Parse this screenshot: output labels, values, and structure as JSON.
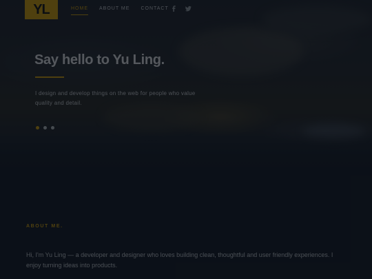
{
  "header": {
    "logo": "YL",
    "nav": [
      "Home",
      "About Me",
      "Contact"
    ],
    "social": [
      "facebook-icon",
      "twitter-icon"
    ]
  },
  "hero": {
    "title": "Say hello to Yu Ling.",
    "subtitle": "I design and develop things on the web for people who value quality and detail.",
    "slides": 3,
    "active_slide": 0
  },
  "about": {
    "label": "ABOUT ME.",
    "text": "Hi, I'm Yu Ling — a developer and designer who loves building clean, thoughtful and user friendly experiences. I enjoy turning ideas into products."
  },
  "colors": {
    "accent": "#d8a40a",
    "background": "#141a24"
  }
}
